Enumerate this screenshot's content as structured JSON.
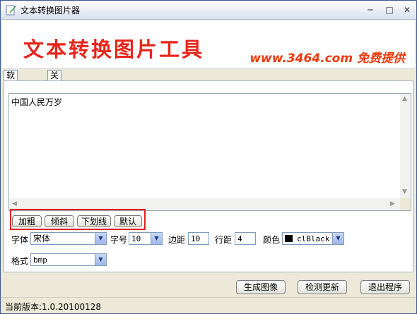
{
  "window": {
    "title": "文本转换图片器"
  },
  "title_buttons": {
    "minimize": "─",
    "maximize": "□",
    "close": "✕"
  },
  "banner": {
    "title": "文本转换图片工具",
    "site": "www.3464.com 免费提供"
  },
  "tabs": [
    {
      "label": "软件设置",
      "active": true
    },
    {
      "label": "关于我们",
      "active": false
    }
  ],
  "editor": {
    "text": "中国人民万岁"
  },
  "style_buttons": {
    "bold": "加粗",
    "italic": "倾斜",
    "underline": "下划线",
    "default": "默认"
  },
  "settings": {
    "font_label": "字体",
    "font_value": "宋体",
    "size_label": "字号",
    "size_value": "10",
    "margin_label": "边距",
    "margin_value": "10",
    "spacing_label": "行距",
    "spacing_value": "4",
    "color_label": "颜色",
    "color_value": "clBlack",
    "format_label": "格式",
    "format_value": "bmp"
  },
  "actions": {
    "generate": "生成图像",
    "check_update": "检测更新",
    "exit": "退出程序"
  },
  "status": {
    "version": "当前版本:1.0.20100128"
  },
  "colors": {
    "banner_red": "#e8251a",
    "highlight": "#e02020",
    "swatch": "#000000"
  }
}
